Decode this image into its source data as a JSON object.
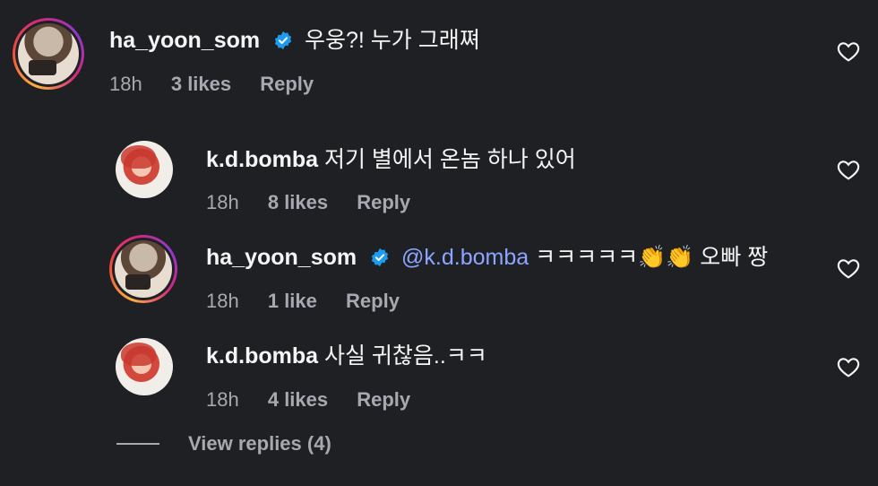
{
  "comments": [
    {
      "username": "ha_yoon_som",
      "verified": true,
      "mention": "",
      "text": "우웅?! 누가 그래쪄",
      "time": "18h",
      "likes": "3 likes",
      "reply": "Reply"
    },
    {
      "username": "k.d.bomba",
      "verified": false,
      "mention": "",
      "text": "저기 별에서 온놈 하나 있어",
      "time": "18h",
      "likes": "8 likes",
      "reply": "Reply"
    },
    {
      "username": "ha_yoon_som",
      "verified": true,
      "mention": "@k.d.bomba",
      "text": "ㅋㅋㅋㅋㅋ👏👏 오빠 짱",
      "time": "18h",
      "likes": "1 like",
      "reply": "Reply"
    },
    {
      "username": "k.d.bomba",
      "verified": false,
      "mention": "",
      "text": "사실 귀찮음..ㅋㅋ",
      "time": "18h",
      "likes": "4 likes",
      "reply": "Reply"
    }
  ],
  "view_replies": "View replies (4)",
  "colors": {
    "background": "#1f2024",
    "mention": "#8aa6ff",
    "verified": "#1d9bf0",
    "meta": "#a8a8b0"
  }
}
